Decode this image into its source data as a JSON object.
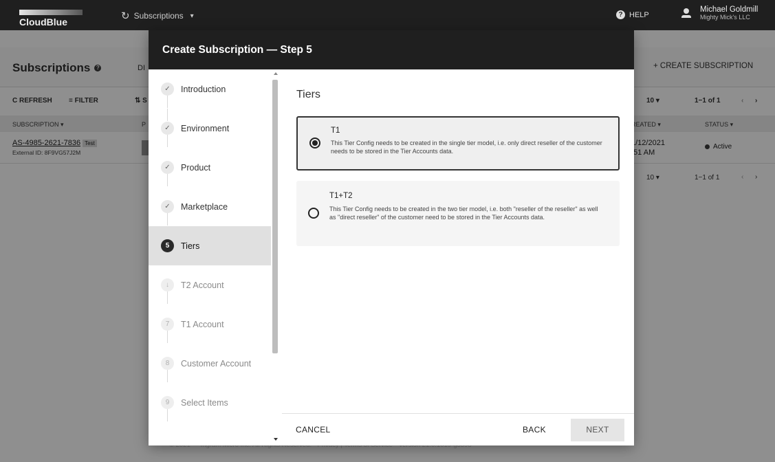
{
  "app": {
    "logo": "CloudBlue",
    "module": "Subscriptions",
    "help": "HELP",
    "user_name": "Michael Goldmill",
    "user_org": "Mighty Mick's LLC"
  },
  "page": {
    "title": "Subscriptions",
    "tab_truncated": "DI",
    "create_button": "+ CREATE SUBSCRIPTION",
    "refresh": "C REFRESH",
    "filter": "≡ FILTER",
    "sort_trunc": "⇅ S",
    "rows_per_page_top": "10 ▾",
    "range_top": "1−1 of 1",
    "rows_per_page_bottom": "10 ▾",
    "range_bottom": "1−1 of 1",
    "columns": {
      "subscription": "SUBSCRIPTION ▾",
      "p": "P",
      "created": "REATED ▾",
      "status": "STATUS ▾"
    },
    "row": {
      "id": "AS-4985-2621-7836",
      "badge": "Test",
      "external_id": "External ID: 8F9VG57J2M",
      "date_line1": "1/12/2021",
      "date_line2": ":51 AM",
      "status": "Active"
    },
    "footer": "© 2021 — Ingram Micro Inc. All Rights Reserved. · Privacy | Terms of Service · Version 21.0.1019-g3398"
  },
  "dialog": {
    "title": "Create Subscription — Step 5",
    "steps": [
      {
        "num": "✓",
        "label": "Introduction",
        "state": "done"
      },
      {
        "num": "✓",
        "label": "Environment",
        "state": "done"
      },
      {
        "num": "✓",
        "label": "Product",
        "state": "done"
      },
      {
        "num": "✓",
        "label": "Marketplace",
        "state": "done"
      },
      {
        "num": "5",
        "label": "Tiers",
        "state": "current"
      },
      {
        "num": "↓",
        "label": "T2 Account",
        "state": "future"
      },
      {
        "num": "7",
        "label": "T1 Account",
        "state": "future"
      },
      {
        "num": "8",
        "label": "Customer Account",
        "state": "future"
      },
      {
        "num": "9",
        "label": "Select Items",
        "state": "future"
      }
    ],
    "section_title": "Tiers",
    "options": [
      {
        "name": "T1",
        "description": "This Tier Config needs to be created in the single tier model, i.e. only direct reseller of the customer needs to be stored in the Tier Accounts data.",
        "selected": true
      },
      {
        "name": "T1+T2",
        "description": "This Tier Config needs to be created in the two tier model, i.e. both \"reseller of the reseller\" as well as \"direct reseller\" of the customer need to be stored in the Tier Accounts data.",
        "selected": false
      }
    ],
    "cancel": "CANCEL",
    "back": "BACK",
    "next": "NEXT"
  }
}
